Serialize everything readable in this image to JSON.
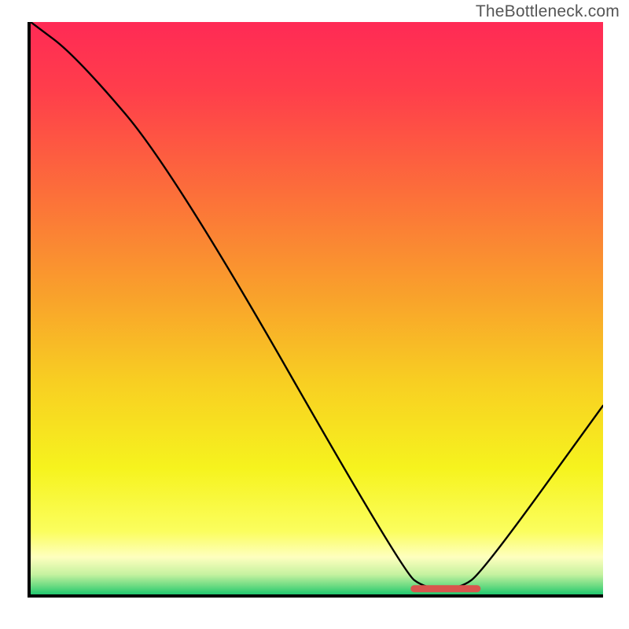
{
  "watermark": "TheBottleneck.com",
  "chart_data": {
    "type": "line",
    "title": "",
    "xlabel": "",
    "ylabel": "",
    "xlim": [
      0,
      100
    ],
    "ylim": [
      0,
      100
    ],
    "grid": false,
    "legend": false,
    "series": [
      {
        "name": "bottleneck-curve",
        "color": "#000000",
        "x": [
          0,
          8,
          25,
          65,
          69,
          75,
          79,
          100
        ],
        "values": [
          100,
          94,
          74,
          4,
          1,
          1,
          4,
          33
        ]
      }
    ],
    "marker": {
      "name": "optimal-range",
      "color": "#D9544D",
      "x_start": 67,
      "x_end": 78,
      "y": 1
    },
    "gradient_stops": [
      {
        "offset": 0.0,
        "color": "#FF2A55"
      },
      {
        "offset": 0.12,
        "color": "#FF3E4B"
      },
      {
        "offset": 0.3,
        "color": "#FC6F3A"
      },
      {
        "offset": 0.48,
        "color": "#F9A22B"
      },
      {
        "offset": 0.63,
        "color": "#F8CF22"
      },
      {
        "offset": 0.78,
        "color": "#F6F31E"
      },
      {
        "offset": 0.89,
        "color": "#FBFE5E"
      },
      {
        "offset": 0.935,
        "color": "#FEFFBF"
      },
      {
        "offset": 0.965,
        "color": "#C6F2A0"
      },
      {
        "offset": 0.985,
        "color": "#6CDB82"
      },
      {
        "offset": 1.0,
        "color": "#21C86F"
      }
    ]
  }
}
